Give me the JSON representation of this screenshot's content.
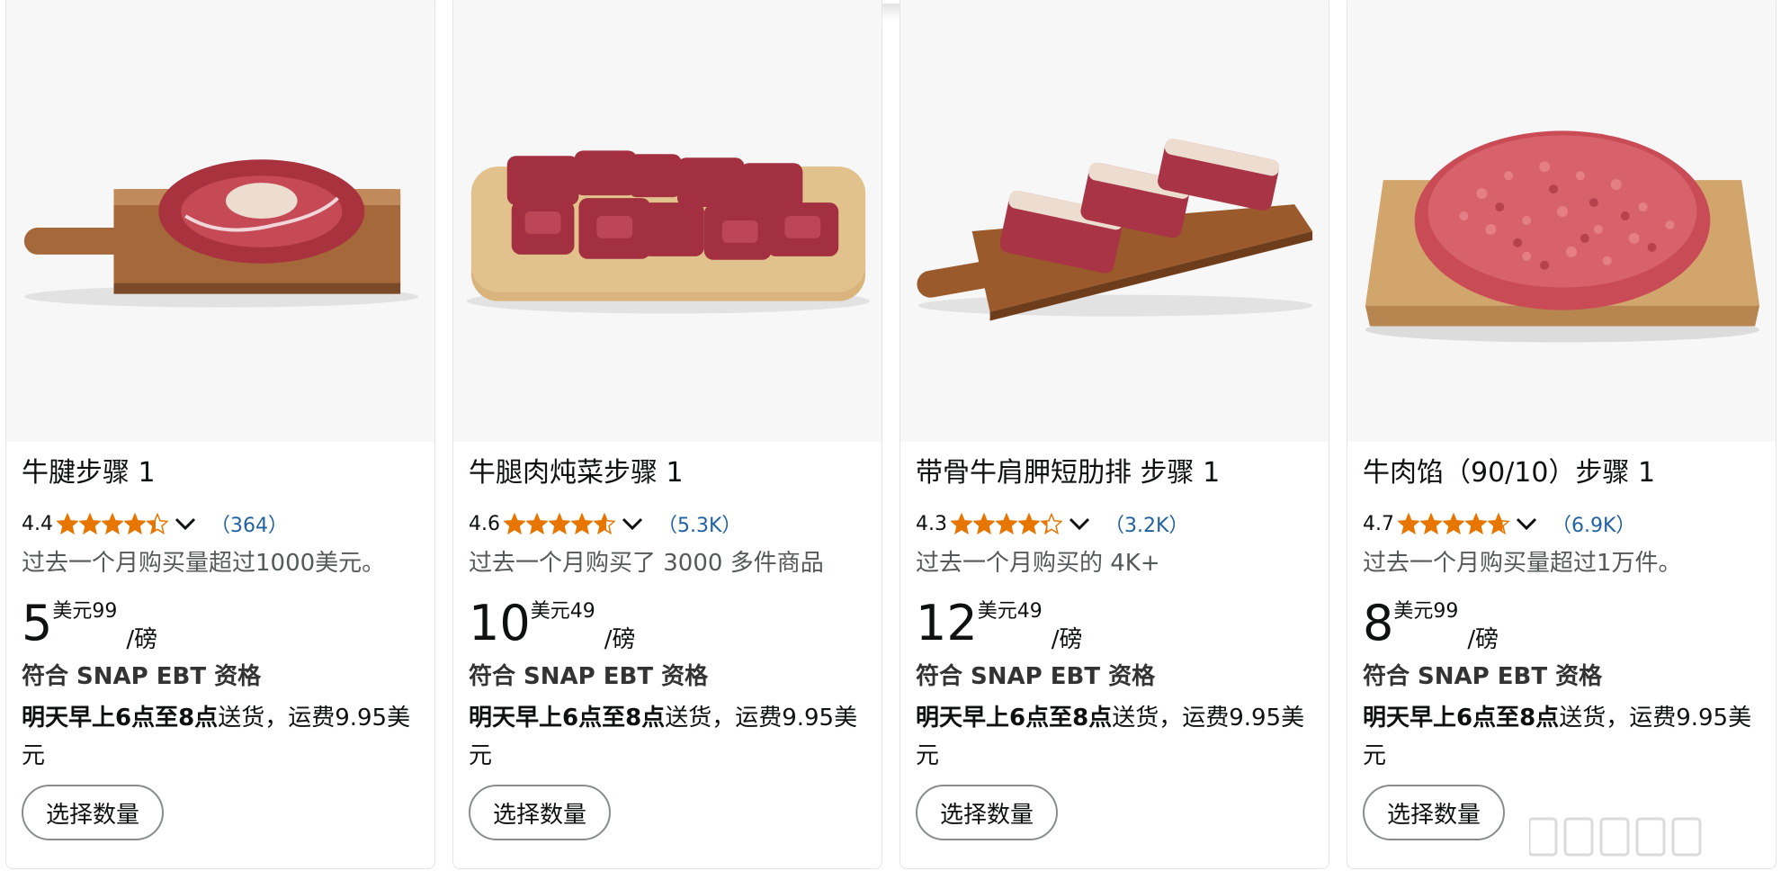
{
  "products": [
    {
      "title": "牛腱步骤 1",
      "rating": "4.4",
      "stars": 4.4,
      "review_count": "（364）",
      "bought": "过去一个月购买量超过1000美元。",
      "price_whole": "5",
      "price_currency_fraction": "美元99",
      "price_unit": "/磅",
      "snap": "符合 SNAP EBT 资格",
      "delivery_bold": "明天早上6点至8点",
      "delivery_rest": "送货，运费9.95美元",
      "button": "选择数量",
      "image_icon": "beef-shank-on-board"
    },
    {
      "title": "牛腿肉炖菜步骤 1",
      "rating": "4.6",
      "stars": 4.6,
      "review_count": "（5.3K）",
      "bought": "过去一个月购买了 3000 多件商品",
      "price_whole": "10",
      "price_currency_fraction": "美元49",
      "price_unit": "/磅",
      "snap": "符合 SNAP EBT 资格",
      "delivery_bold": "明天早上6点至8点",
      "delivery_rest": "送货，运费9.95美元",
      "button": "选择数量",
      "image_icon": "stew-meat-on-board"
    },
    {
      "title": "带骨牛肩胛短肋排 步骤 1",
      "rating": "4.3",
      "stars": 4.3,
      "review_count": "（3.2K）",
      "bought": "过去一个月购买的 4K+",
      "price_whole": "12",
      "price_currency_fraction": "美元49",
      "price_unit": "/磅",
      "snap": "符合 SNAP EBT 资格",
      "delivery_bold": "明天早上6点至8点",
      "delivery_rest": "送货，运费9.95美元",
      "button": "选择数量",
      "image_icon": "short-ribs-on-board"
    },
    {
      "title": "牛肉馅（90/10）步骤 1",
      "rating": "4.7",
      "stars": 4.7,
      "review_count": "（6.9K）",
      "bought": "过去一个月购买量超过1万件。",
      "price_whole": "8",
      "price_currency_fraction": "美元99",
      "price_unit": "/磅",
      "snap": "符合 SNAP EBT 资格",
      "delivery_bold": "明天早上6点至8点",
      "delivery_rest": "送货，运费9.95美元",
      "button": "选择数量",
      "image_icon": "ground-beef-on-tray"
    }
  ],
  "colors": {
    "star": "#e77600",
    "link": "#2162a1",
    "secondary_text": "#565959",
    "image_bg": "#f7f7f7"
  }
}
